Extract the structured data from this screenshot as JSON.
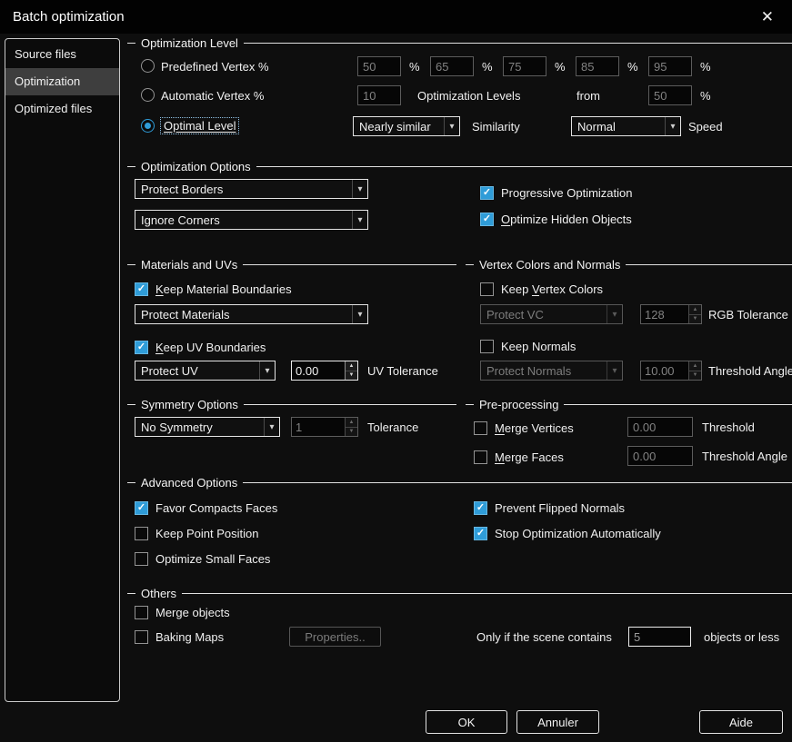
{
  "window": {
    "title": "Batch optimization",
    "close_icon": "✕"
  },
  "icons": {
    "check": "✓",
    "chevron": "▾",
    "spin_up": "▲",
    "spin_down": "▼"
  },
  "sidebar": {
    "items": [
      {
        "label": "Source files",
        "selected": false
      },
      {
        "label": "Optimization",
        "selected": true
      },
      {
        "label": "Optimized files",
        "selected": false
      }
    ]
  },
  "optimization_level": {
    "title": "Optimization Level",
    "predefined_label": "Predefined Vertex %",
    "predefined_selected": false,
    "predefined_values": [
      "50",
      "65",
      "75",
      "85",
      "95"
    ],
    "percent": "%",
    "automatic_label": "Automatic Vertex %",
    "automatic_selected": false,
    "automatic_value": "10",
    "levels_label": "Optimization Levels",
    "from_label": "from",
    "from_value": "50",
    "optimal_label": "Optimal Level",
    "optimal_selected": true,
    "similarity_value": "Nearly similar",
    "similarity_label": "Similarity",
    "speed_value": "Normal",
    "speed_label": "Speed"
  },
  "optimization_options": {
    "title": "Optimization Options",
    "borders_value": "Protect Borders",
    "corners_value": "Ignore Corners",
    "progressive": {
      "label": "Progressive Optimization",
      "checked": true
    },
    "hidden": {
      "u": "O",
      "rest": "ptimize Hidden Objects",
      "checked": true
    }
  },
  "materials": {
    "title": "Materials and UVs",
    "keep_material": {
      "u": "K",
      "rest": "eep Material Boundaries",
      "checked": true
    },
    "protect_materials_value": "Protect Materials",
    "keep_uv": {
      "u": "K",
      "rest": "eep UV Boundaries",
      "checked": true
    },
    "protect_uv_value": "Protect UV",
    "uv_tolerance_value": "0.00",
    "uv_tolerance_label": "UV Tolerance"
  },
  "vertex_colors": {
    "title": "Vertex Colors and Normals",
    "keep_vc": {
      "pre": "Keep ",
      "u": "V",
      "rest": "ertex Colors",
      "checked": false
    },
    "protect_vc_value": "Protect VC",
    "rgb_tolerance_value": "128",
    "rgb_tolerance_label": "RGB Tolerance",
    "keep_normals": {
      "label": "Keep Normals",
      "checked": false
    },
    "protect_normals_value": "Protect Normals",
    "threshold_angle_value": "10.00",
    "threshold_angle_label": "Threshold Angle"
  },
  "symmetry": {
    "title": "Symmetry Options",
    "symmetry_value": "No Symmetry",
    "tolerance_value": "1",
    "tolerance_label": "Tolerance"
  },
  "preprocessing": {
    "title": "Pre-processing",
    "merge_vertices": {
      "u": "M",
      "rest": "erge Vertices",
      "checked": false
    },
    "vert_threshold_value": "0.00",
    "vert_threshold_label": "Threshold",
    "merge_faces": {
      "u": "M",
      "rest": "erge Faces",
      "checked": false
    },
    "face_threshold_value": "0.00",
    "face_threshold_label": "Threshold Angle"
  },
  "advanced": {
    "title": "Advanced Options",
    "favor_compact": {
      "label": "Favor Compacts Faces",
      "checked": true
    },
    "keep_point": {
      "label": "Keep Point Position",
      "checked": false
    },
    "optimize_small": {
      "label": "Optimize Small Faces",
      "checked": false
    },
    "prevent_flipped": {
      "label": "Prevent Flipped Normals",
      "checked": true
    },
    "stop_auto": {
      "label": "Stop Optimization Automatically",
      "checked": true
    }
  },
  "others": {
    "title": "Others",
    "merge_objects": {
      "label": "Merge objects",
      "checked": false
    },
    "baking_maps": {
      "label": "Baking Maps",
      "checked": false
    },
    "properties_label": "Properties..",
    "scene_label": "Only if the scene contains",
    "scene_value": "5",
    "objects_label": "objects or less"
  },
  "footer": {
    "ok": "OK",
    "cancel": "Annuler",
    "help": "Aide"
  }
}
